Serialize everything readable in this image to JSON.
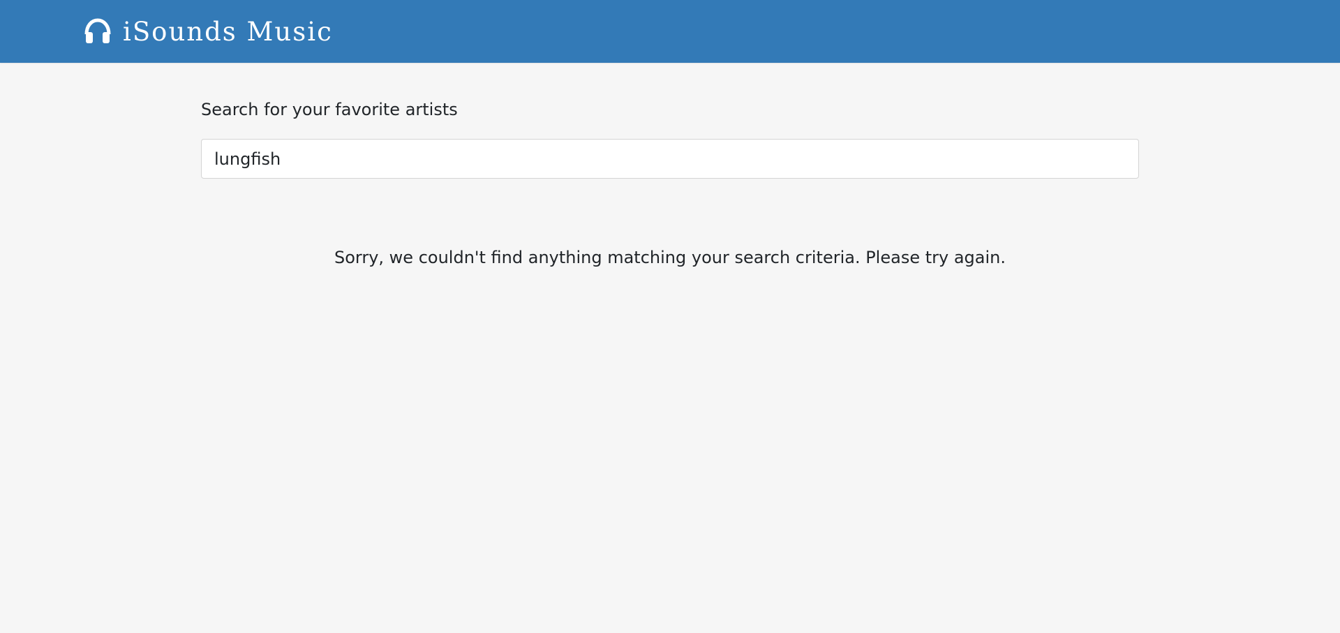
{
  "header": {
    "brand_name": "iSounds Music",
    "brand_icon": "headphones-icon",
    "background_color": "#337ab7"
  },
  "search": {
    "label": "Search for your favorite artists",
    "value": "lungfish",
    "placeholder": ""
  },
  "results": {
    "empty_message": "Sorry, we couldn't find anything matching your search criteria. Please try again."
  },
  "colors": {
    "page_background": "#f6f6f6",
    "text": "#212529",
    "accent": "#337ab7"
  }
}
